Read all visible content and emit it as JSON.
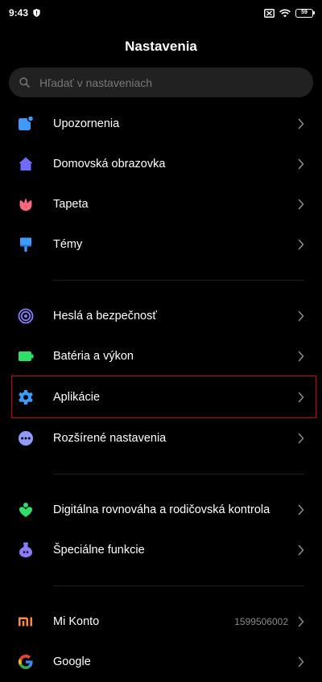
{
  "status": {
    "time": "9:43",
    "battery": "59"
  },
  "title": "Nastavenia",
  "search": {
    "placeholder": "Hľadať v nastaveniach"
  },
  "groups": [
    {
      "items": [
        {
          "label": "Upozornenia",
          "icon": "notifications-icon",
          "color": "#3d9bff"
        },
        {
          "label": "Domovská obrazovka",
          "icon": "home-icon",
          "color": "#6f6cff"
        },
        {
          "label": "Tapeta",
          "icon": "flower-icon",
          "color": "#ff6781"
        },
        {
          "label": "Témy",
          "icon": "brush-icon",
          "color": "#3d9bff"
        }
      ]
    },
    {
      "items": [
        {
          "label": "Heslá a bezpečnosť",
          "icon": "fingerprint-icon",
          "color": "#8a7bff"
        },
        {
          "label": "Batéria a výkon",
          "icon": "battery-icon",
          "color": "#2ee06a"
        },
        {
          "label": "Aplikácie",
          "icon": "gear-icon",
          "color": "#3d9bff",
          "highlighted": true
        },
        {
          "label": "Rozšírené nastavenia",
          "icon": "more-icon",
          "color": "#8f9bff"
        }
      ]
    },
    {
      "items": [
        {
          "label": "Digitálna rovnováha a rodičovská kontrola",
          "icon": "wellbeing-icon",
          "color": "#2ee06a"
        },
        {
          "label": "Špeciálne funkcie",
          "icon": "potion-icon",
          "color": "#8a7bff"
        }
      ]
    },
    {
      "items": [
        {
          "label": "Mi Konto",
          "icon": "mi-icon",
          "color": "#ff8a3d",
          "value": "1599506002"
        },
        {
          "label": "Google",
          "icon": "google-icon"
        }
      ]
    }
  ]
}
